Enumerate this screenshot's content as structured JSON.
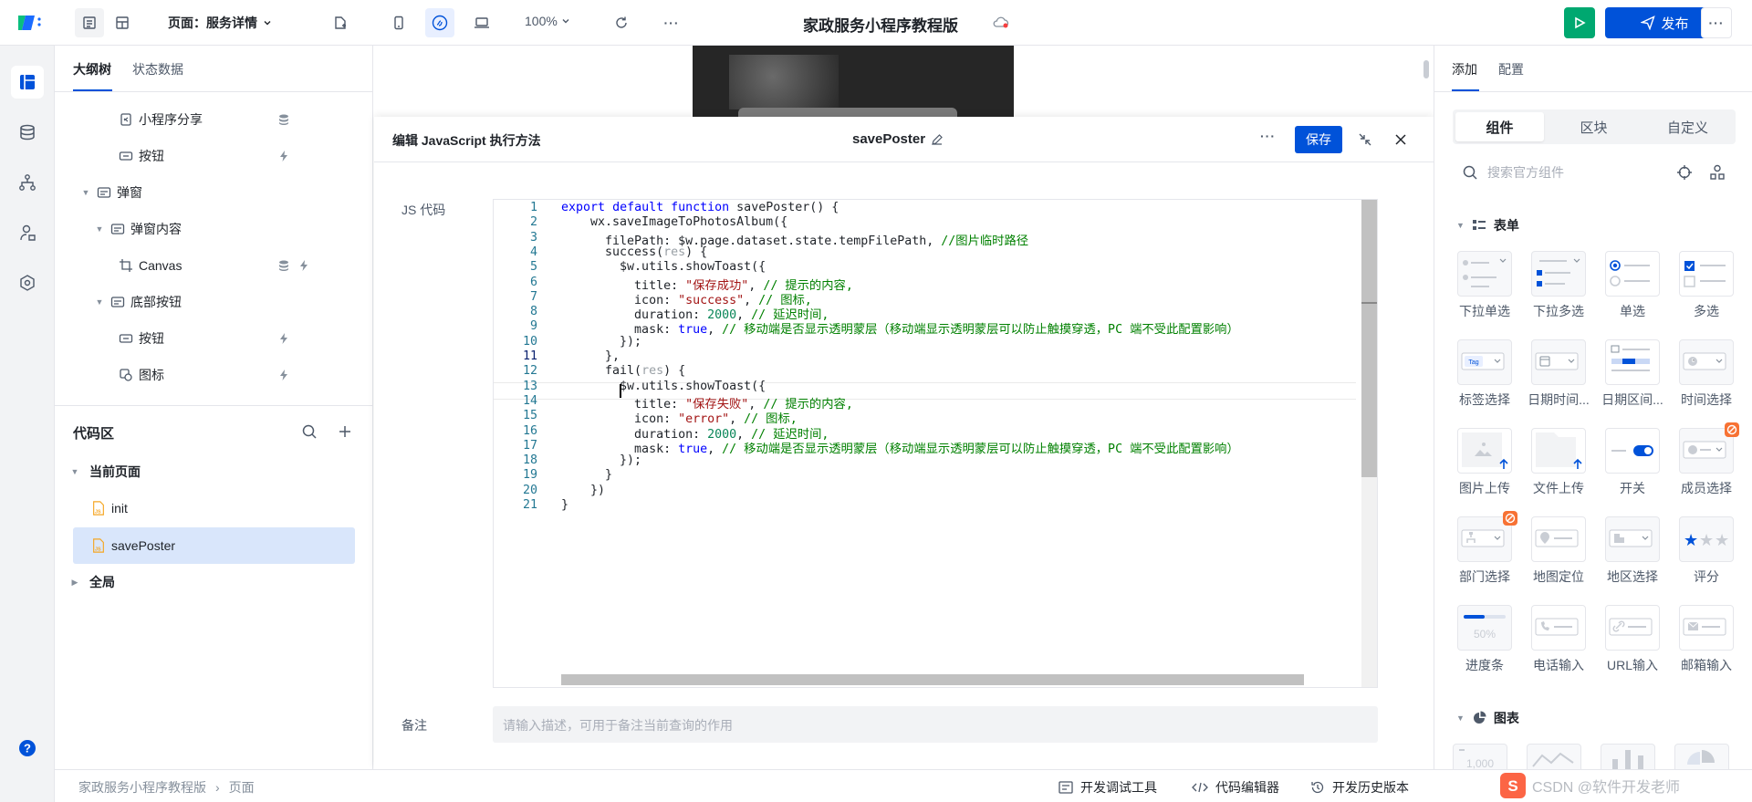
{
  "topbar": {
    "page_label": "页面：服务详情",
    "zoom": "100%",
    "app_title": "家政服务小程序教程版",
    "publish_label": "发布",
    "more": "···"
  },
  "left_tabs": [
    "大纲树",
    "状态数据"
  ],
  "tree": [
    {
      "label": "小程序分享",
      "level": 3
    },
    {
      "label": "按钮",
      "level": 3
    },
    {
      "label": "弹窗",
      "level": 1
    },
    {
      "label": "弹窗内容",
      "level": 2
    },
    {
      "label": "Canvas",
      "level": 3
    },
    {
      "label": "底部按钮",
      "level": 2
    },
    {
      "label": "按钮",
      "level": 3
    },
    {
      "label": "图标",
      "level": 3
    }
  ],
  "code_area": {
    "title": "代码区",
    "current_page": "当前页面",
    "items": [
      "init",
      "savePoster"
    ],
    "global": "全局"
  },
  "modal": {
    "title": "编辑 JavaScript 执行方法",
    "method_name": "savePoster",
    "save_label": "保存",
    "more": "···",
    "js_label": "JS 代码",
    "notes_label": "备注",
    "notes_placeholder": "请输入描述，可用于备注当前查询的作用"
  },
  "code_lines": [
    "export default function savePoster() {",
    "    wx.saveImageToPhotosAlbum({",
    "      filePath: $w.page.dataset.state.tempFilePath, //图片临时路径",
    "      success(res) {",
    "        $w.utils.showToast({",
    "          title: \"保存成功\", // 提示的内容,",
    "          icon: \"success\", // 图标,",
    "          duration: 2000, // 延迟时间,",
    "          mask: true, // 移动端是否显示透明蒙层（移动端显示透明蒙层可以防止触摸穿透，PC 端不受此配置影响）",
    "        });",
    "      },",
    "      fail(res) {",
    "        $w.utils.showToast({",
    "          title: \"保存失败\", // 提示的内容,",
    "          icon: \"error\", // 图标,",
    "          duration: 2000, // 延迟时间,",
    "          mask: true, // 移动端是否显示透明蒙层（移动端显示透明蒙层可以防止触摸穿透，PC 端不受此配置影响）",
    "        });",
    "      }",
    "    })",
    "}"
  ],
  "line_numbers": [
    "1",
    "2",
    "3",
    "4",
    "5",
    "6",
    "7",
    "8",
    "9",
    "10",
    "11",
    "12",
    "13",
    "14",
    "15",
    "16",
    "17",
    "18",
    "19",
    "20",
    "21"
  ],
  "right_tabs": [
    "添加",
    "配置"
  ],
  "segments": [
    "组件",
    "区块",
    "自定义"
  ],
  "search_placeholder": "搜索官方组件",
  "sections": {
    "form": "表单",
    "chart": "图表"
  },
  "components": [
    "下拉单选",
    "下拉多选",
    "单选",
    "多选",
    "标签选择",
    "日期时间...",
    "日期区间...",
    "时间选择",
    "图片上传",
    "文件上传",
    "开关",
    "成员选择",
    "部门选择",
    "地图定位",
    "地区选择",
    "评分",
    "进度条",
    "电话输入",
    "URL输入",
    "邮箱输入"
  ],
  "thumb_text": {
    "tag": "Tag",
    "progress": "50%",
    "chart_num": "1,000"
  },
  "breadcrumb": [
    "家政服务小程序教程版",
    "页面"
  ],
  "bottom_tools": [
    "开发调试工具",
    "代码编辑器",
    "开发历史版本"
  ],
  "watermark": "CSDN @软件开发老师",
  "colors": {
    "primary": "#0052d9",
    "green": "#00a870",
    "selected_bg": "#d9e6fb"
  }
}
